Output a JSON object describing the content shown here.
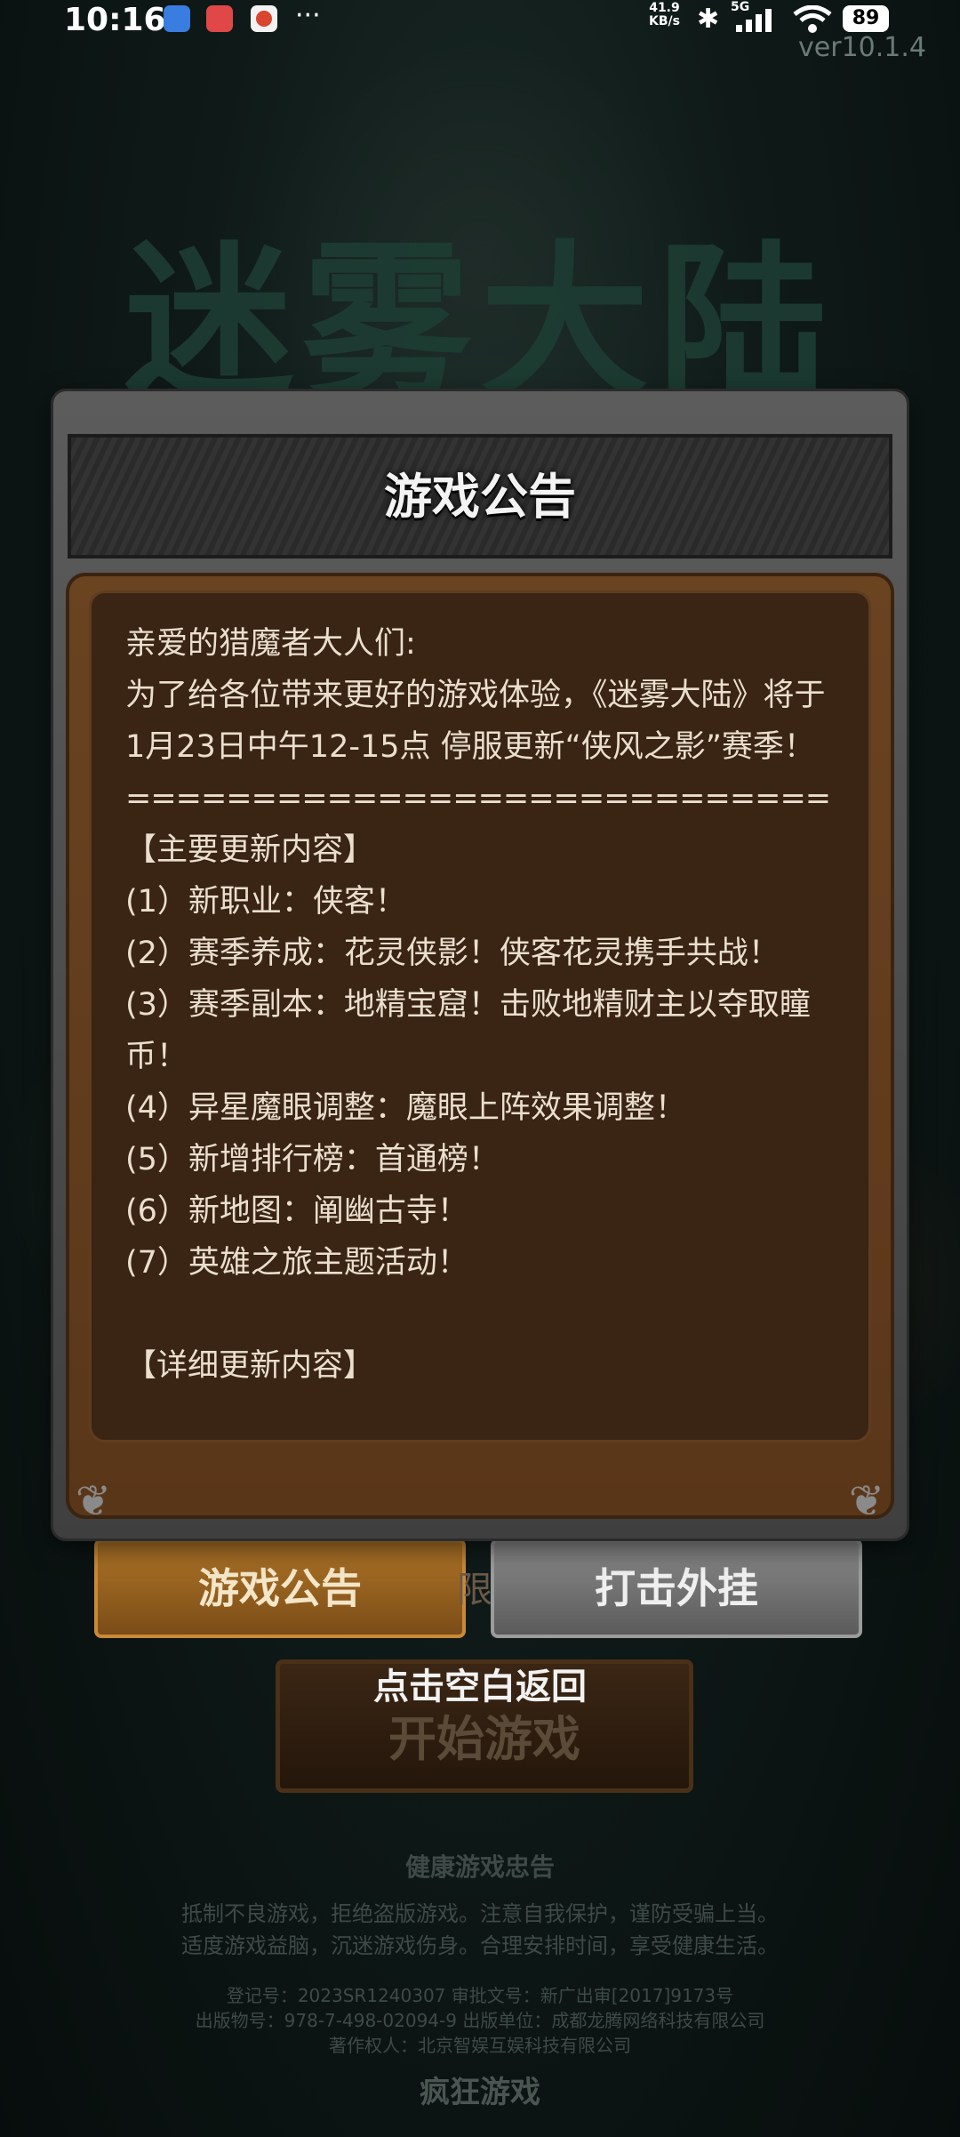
{
  "status_bar": {
    "time": "10:16",
    "more": "···",
    "net_speed_value": "41.9",
    "net_speed_unit": "KB/s",
    "network": "5G",
    "battery": "89"
  },
  "version": "ver10.1.4",
  "logo_text": "迷雾大陆",
  "dialog": {
    "title": "游戏公告",
    "lines": [
      "亲爱的猎魔者大人们:",
      "为了给各位带来更好的游戏体验，《迷雾大陆》将于 1月23日中午12-15点 停服更新“侠风之影”赛季！",
      "============================",
      "【主要更新内容】",
      "(1）新职业：侠客！",
      "(2）赛季养成：花灵侠影！侠客花灵携手共战！",
      "(3）赛季副本：地精宝窟！击败地精财主以夺取瞳币！",
      "(4）异星魔眼调整：魔眼上阵效果调整！",
      "(5）新增排行榜：首通榜！",
      "(6）新地图：阐幽古寺！",
      "(7）英雄之旅主题活动！",
      "",
      "【详细更新内容】"
    ]
  },
  "buttons": {
    "announcement": "游戏公告",
    "anti_cheat": "打击外挂",
    "start_game": "开始游戏",
    "tap_to_return": "点击空白返回"
  },
  "footer": {
    "title": "健康游戏忠告",
    "line1": "抵制不良游戏，拒绝盗版游戏。注意自我保护，谨防受骗上当。",
    "line2": "适度游戏益脑，沉迷游戏伤身。合理安排时间，享受健康生活。",
    "reg": "登记号：2023SR1240307    审批文号：新广出审[2017]9173号",
    "isbn": "出版物号：978-7-498-02094-9    出版单位：成都龙腾网络科技有限公司",
    "owner": "著作权人：北京智娱互娱科技有限公司",
    "brand": "疯狂游戏"
  }
}
